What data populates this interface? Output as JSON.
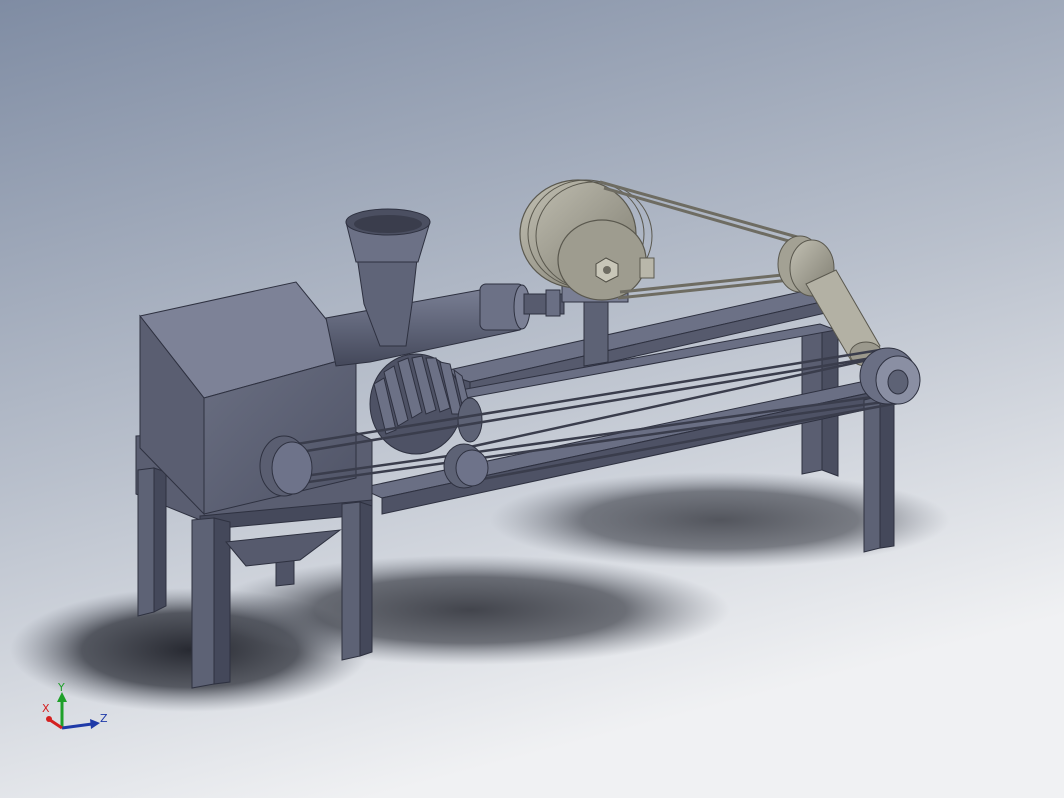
{
  "viewport": {
    "background_top": "#8693a8",
    "background_bottom": "#eef0f2",
    "part_color": "#5d6275",
    "part_dark": "#3e4254",
    "part_light": "#7b8095",
    "metal_color": "#8e8c80",
    "metal_light": "#b5b3a6",
    "shadow_color": "#1e2028"
  },
  "triad": {
    "x_label": "X",
    "y_label": "Y",
    "z_label": "Z",
    "x_color": "#d42020",
    "y_color": "#1fa02a",
    "z_color": "#1f3aa8"
  }
}
